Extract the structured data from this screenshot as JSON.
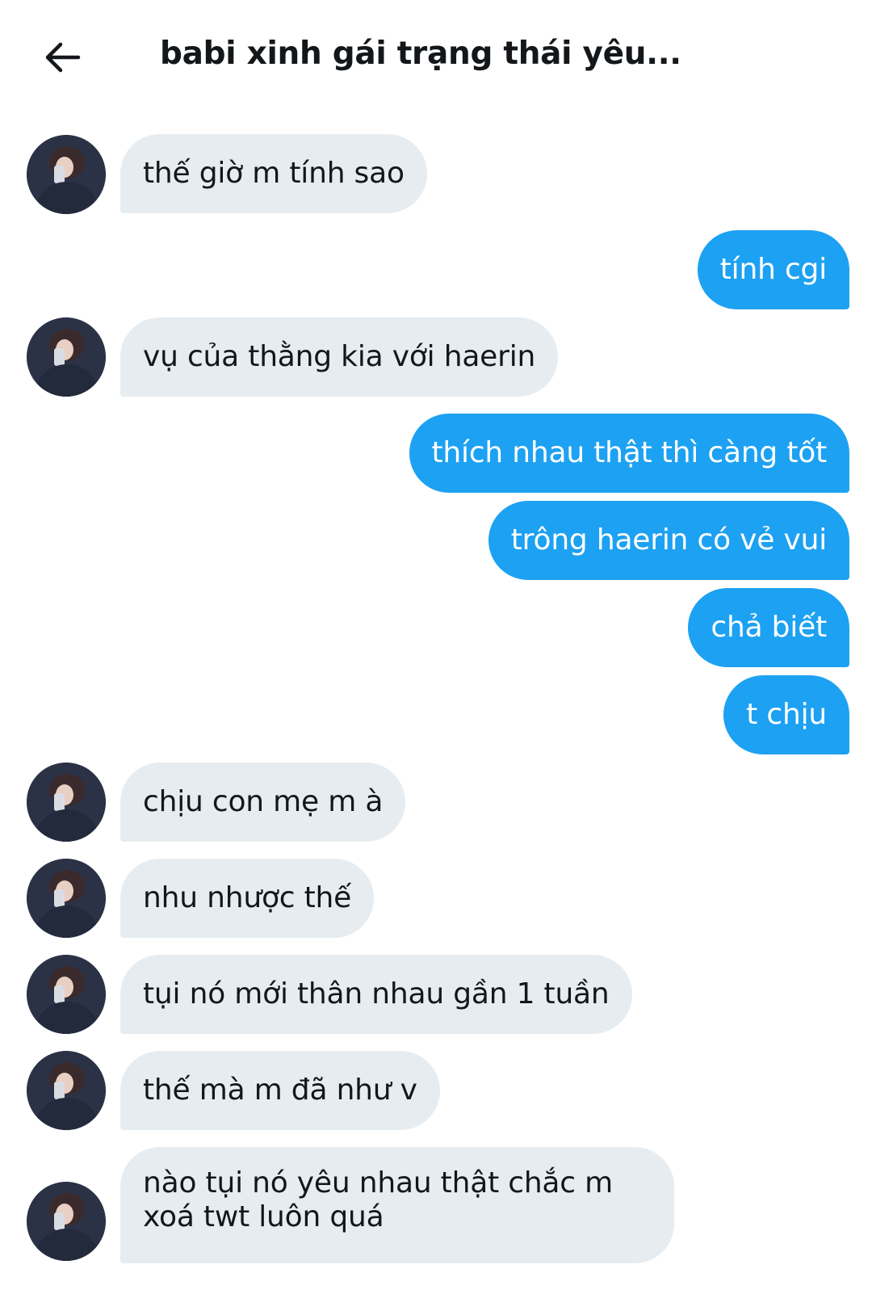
{
  "header": {
    "title": "babi xinh gái trạng thái yêu..."
  },
  "theme": {
    "outgoing_bubble": "#1da1f2",
    "incoming_bubble": "#e6ecf0"
  },
  "messages": [
    {
      "from": "them",
      "text": "thế giờ m tính sao"
    },
    {
      "from": "me",
      "text": "tính cgi"
    },
    {
      "from": "them",
      "text": "vụ của thằng kia với haerin"
    },
    {
      "from": "me",
      "text": "thích nhau thật thì càng tốt"
    },
    {
      "from": "me",
      "text": "trông haerin có vẻ vui"
    },
    {
      "from": "me",
      "text": "chả biết"
    },
    {
      "from": "me",
      "text": "t chịu"
    },
    {
      "from": "them",
      "text": "chịu con mẹ m à"
    },
    {
      "from": "them",
      "text": "nhu nhược thế"
    },
    {
      "from": "them",
      "text": "tụi nó mới thân nhau gần 1 tuần"
    },
    {
      "from": "them",
      "text": "thế mà m đã như v"
    },
    {
      "from": "them",
      "text": "nào tụi nó yêu nhau thật chắc m xoá twt luôn quá"
    }
  ]
}
